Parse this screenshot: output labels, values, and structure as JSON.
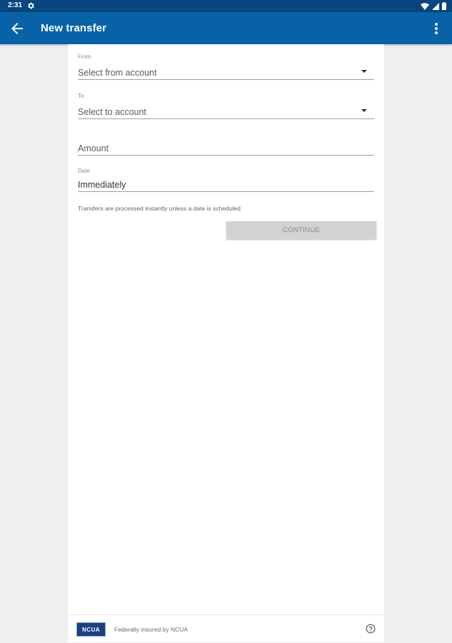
{
  "status_bar": {
    "time": "2:31",
    "icons": [
      "settings-icon",
      "wifi-icon",
      "signal-icon",
      "battery-icon"
    ]
  },
  "app_bar": {
    "title": "New transfer",
    "back_icon": "arrow-back-icon",
    "menu_icon": "more-vert-icon",
    "color": "#0862a8"
  },
  "form": {
    "from": {
      "label": "From",
      "placeholder": "Select from account"
    },
    "to": {
      "label": "To",
      "placeholder": "Select to account"
    },
    "amount": {
      "placeholder": "Amount"
    },
    "date": {
      "label": "Date",
      "value": "Immediately"
    },
    "note": "Transfers are processed instantly unless a date is scheduled.",
    "continue_label": "CONTINUE"
  },
  "footer": {
    "logo_text": "NCUA",
    "insured_text": "Federally insured by NCUA",
    "help_icon": "help-circle-icon"
  }
}
